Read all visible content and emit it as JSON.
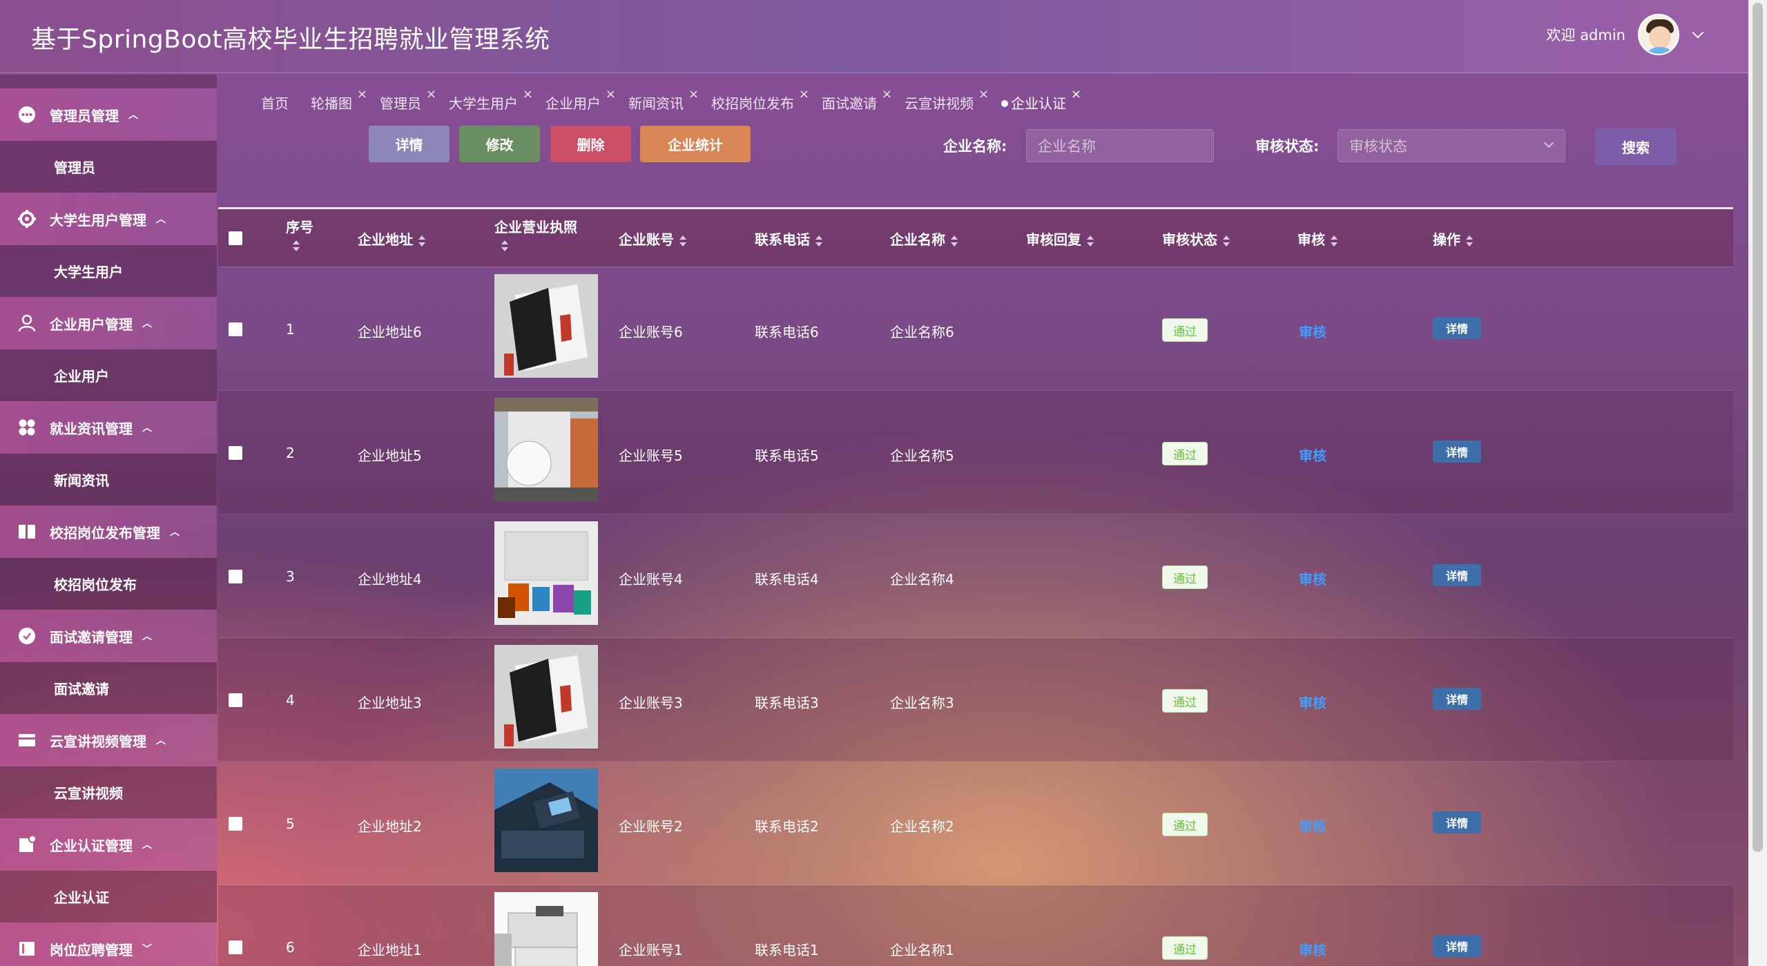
{
  "header": {
    "title": "基于SpringBoot高校毕业生招聘就业管理系统",
    "welcome": "欢迎 admin"
  },
  "sidebar": {
    "groups": [
      {
        "label": "管理员管理",
        "icon": "more-dots-icon",
        "items": [
          "管理员"
        ]
      },
      {
        "label": "大学生用户管理",
        "icon": "gear-icon",
        "items": [
          "大学生用户"
        ]
      },
      {
        "label": "企业用户管理",
        "icon": "user-icon",
        "items": [
          "企业用户"
        ]
      },
      {
        "label": "就业资讯管理",
        "icon": "grid-icon",
        "items": [
          "新闻资讯"
        ]
      },
      {
        "label": "校招岗位发布管理",
        "icon": "columns-icon",
        "items": [
          "校招岗位发布"
        ]
      },
      {
        "label": "面试邀请管理",
        "icon": "check-circle-icon",
        "items": [
          "面试邀请"
        ]
      },
      {
        "label": "云宣讲视频管理",
        "icon": "card-icon",
        "items": [
          "云宣讲视频"
        ]
      },
      {
        "label": "企业认证管理",
        "icon": "doc-icon",
        "items": [
          "企业认证"
        ]
      },
      {
        "label": "岗位应聘管理",
        "icon": "square-icon",
        "items": []
      }
    ]
  },
  "tabs": [
    "首页",
    "轮播图",
    "管理员",
    "大学生用户",
    "企业用户",
    "新闻资讯",
    "校招岗位发布",
    "面试邀请",
    "云宣讲视频",
    "企业认证"
  ],
  "active_tab": "企业认证",
  "toolbar": {
    "detail": "详情",
    "edit": "修改",
    "delete": "删除",
    "stats": "企业统计",
    "search": "搜索",
    "name_label": "企业名称:",
    "name_placeholder": "企业名称",
    "status_label": "审核状态:",
    "status_placeholder": "审核状态"
  },
  "table": {
    "columns": [
      "序号",
      "企业地址",
      "企业营业执照",
      "企业账号",
      "联系电话",
      "企业名称",
      "审核回复",
      "审核状态",
      "审核",
      "操作"
    ],
    "rows": [
      {
        "no": "1",
        "address": "企业地址6",
        "account": "企业账号6",
        "phone": "联系电话6",
        "name": "企业名称6",
        "reply": "",
        "status": "通过",
        "review": "审核",
        "op": "详情"
      },
      {
        "no": "2",
        "address": "企业地址5",
        "account": "企业账号5",
        "phone": "联系电话5",
        "name": "企业名称5",
        "reply": "",
        "status": "通过",
        "review": "审核",
        "op": "详情"
      },
      {
        "no": "3",
        "address": "企业地址4",
        "account": "企业账号4",
        "phone": "联系电话4",
        "name": "企业名称4",
        "reply": "",
        "status": "通过",
        "review": "审核",
        "op": "详情"
      },
      {
        "no": "4",
        "address": "企业地址3",
        "account": "企业账号3",
        "phone": "联系电话3",
        "name": "企业名称3",
        "reply": "",
        "status": "通过",
        "review": "审核",
        "op": "详情"
      },
      {
        "no": "5",
        "address": "企业地址2",
        "account": "企业账号2",
        "phone": "联系电话2",
        "name": "企业名称2",
        "reply": "",
        "status": "通过",
        "review": "审核",
        "op": "详情"
      },
      {
        "no": "6",
        "address": "企业地址1",
        "account": "企业账号1",
        "phone": "联系电话1",
        "name": "企业名称1",
        "reply": "",
        "status": "通过",
        "review": "审核",
        "op": "详情"
      }
    ]
  },
  "colors": {
    "badge_text": "#67c23a",
    "link": "#409eff",
    "detail_btn": "#8d86b8",
    "edit_btn": "#6b8d62",
    "delete_btn": "#cc4d66",
    "stats_btn": "#d98657",
    "search_btn": "#7d5da8"
  }
}
